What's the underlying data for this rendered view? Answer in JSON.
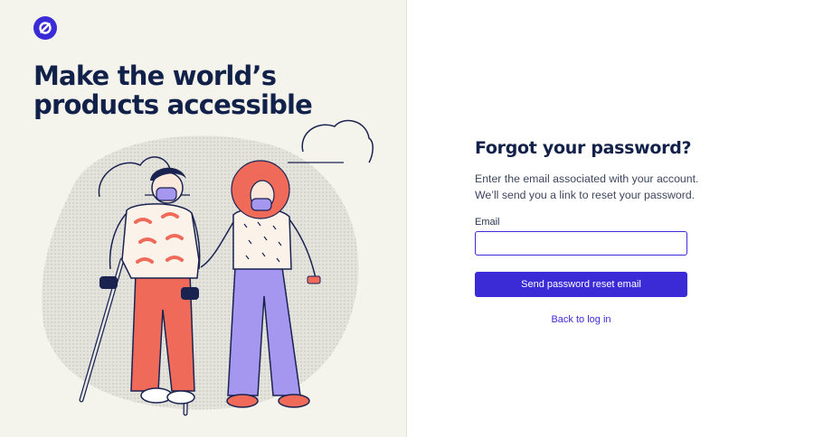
{
  "brand": {
    "logo_icon": "slashed-circle-logo-icon",
    "accent_color": "#3a2bd6",
    "headline_color": "#11214a",
    "panel_background": "#f5f4ec"
  },
  "hero": {
    "headline_line1": "Make the world’s",
    "headline_line2": "products accessible",
    "illustration": "two-people-walking-crutches-illustration"
  },
  "form": {
    "title": "Forgot your password?",
    "description_line1": "Enter the email associated with your account.",
    "description_line2": "We’ll send you a link to reset your password.",
    "email_label": "Email",
    "email_value": "",
    "email_placeholder": "",
    "submit_label": "Send password reset email",
    "back_link_label": "Back to log in"
  }
}
